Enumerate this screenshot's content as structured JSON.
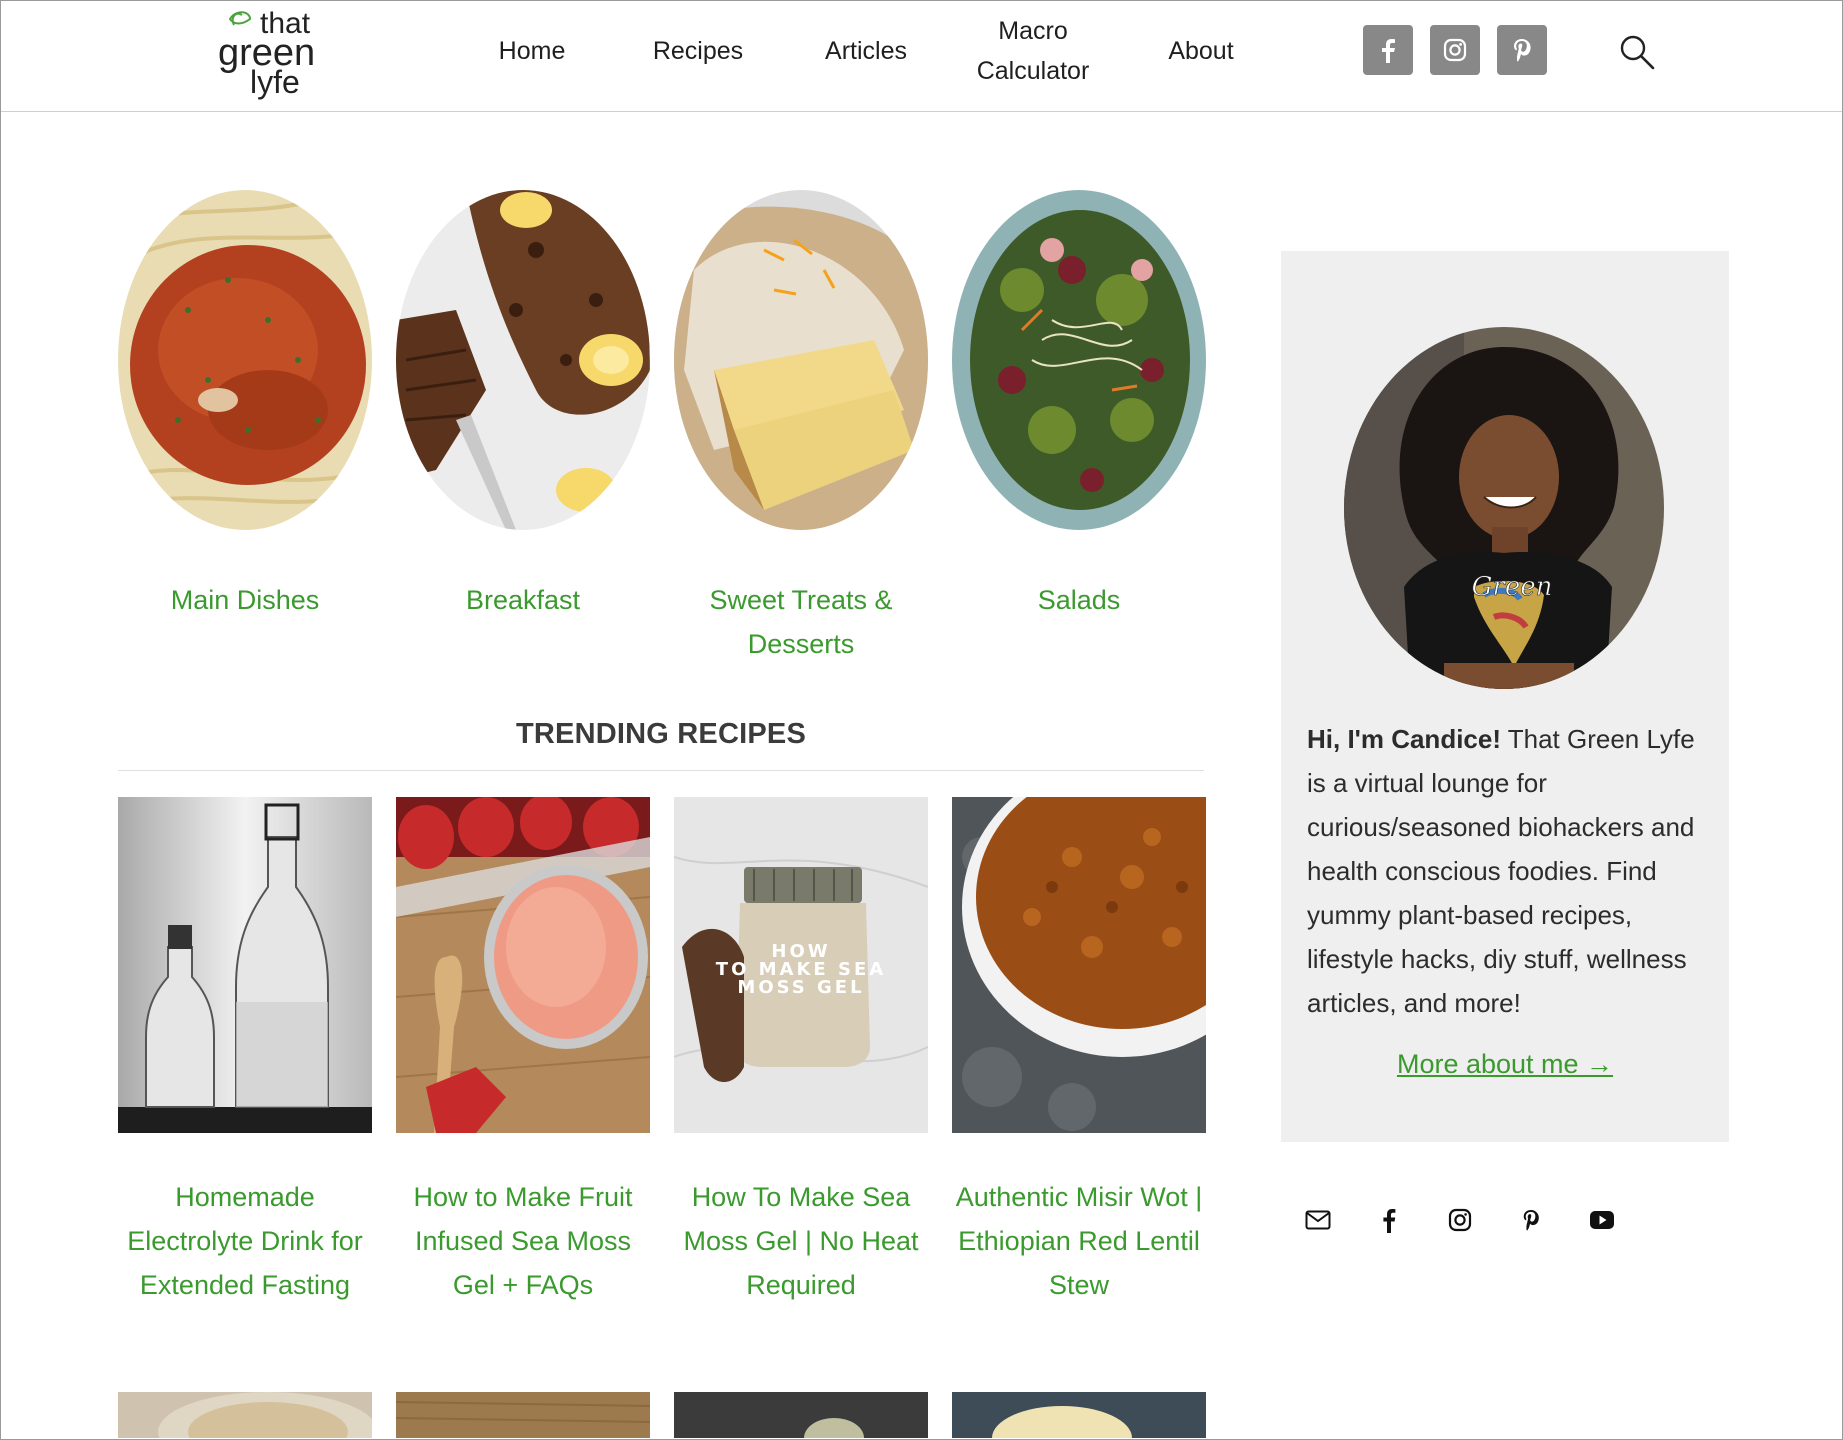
{
  "brand": {
    "logo_line1": "that",
    "logo_line2": "green",
    "logo_line3": "lyfe"
  },
  "nav": {
    "home": "Home",
    "recipes": "Recipes",
    "articles": "Articles",
    "macro_line1": "Macro",
    "macro_line2": "Calculator",
    "about": "About"
  },
  "header_social": {
    "facebook_icon": "facebook-icon",
    "instagram_icon": "instagram-icon",
    "pinterest_icon": "pinterest-icon",
    "search_icon": "search-icon"
  },
  "categories": [
    {
      "label": "Main Dishes"
    },
    {
      "label": "Breakfast"
    },
    {
      "label_line1": "Sweet Treats &",
      "label_line2": "Desserts"
    },
    {
      "label": "Salads"
    }
  ],
  "trending": {
    "heading": "TRENDING RECIPES",
    "cards": [
      {
        "line1": "Homemade",
        "line2": "Electrolyte Drink for",
        "line3": "Extended Fasting"
      },
      {
        "line1": "How to Make Fruit",
        "line2": "Infused Sea Moss",
        "line3": "Gel + FAQs"
      },
      {
        "line1": "How To Make Sea",
        "line2": "Moss Gel | No Heat",
        "line3": "Required",
        "overlay_line1": "HOW",
        "overlay_line2": "TO MAKE SEA",
        "overlay_line3": "MOSS GEL"
      },
      {
        "line1": "Authentic Misir Wot |",
        "line2": "Ethiopian Red Lentil",
        "line3": "Stew"
      }
    ]
  },
  "sidebar": {
    "greeting": "Hi, I'm Candice!",
    "bio": " That Green Lyfe is a virtual lounge for curious/seasoned biohackers and health conscious foodies. Find yummy plant-based recipes, lifestyle hacks, diy stuff, wellness articles, and more!",
    "shirt_text": "Green",
    "more_link": "More about me →"
  },
  "follow_icons": [
    "email-icon",
    "facebook-icon",
    "instagram-icon",
    "pinterest-icon",
    "youtube-icon"
  ],
  "colors": {
    "link_green": "#3a9a2e",
    "social_gray": "#888888",
    "sidebar_bg": "#efefef"
  }
}
